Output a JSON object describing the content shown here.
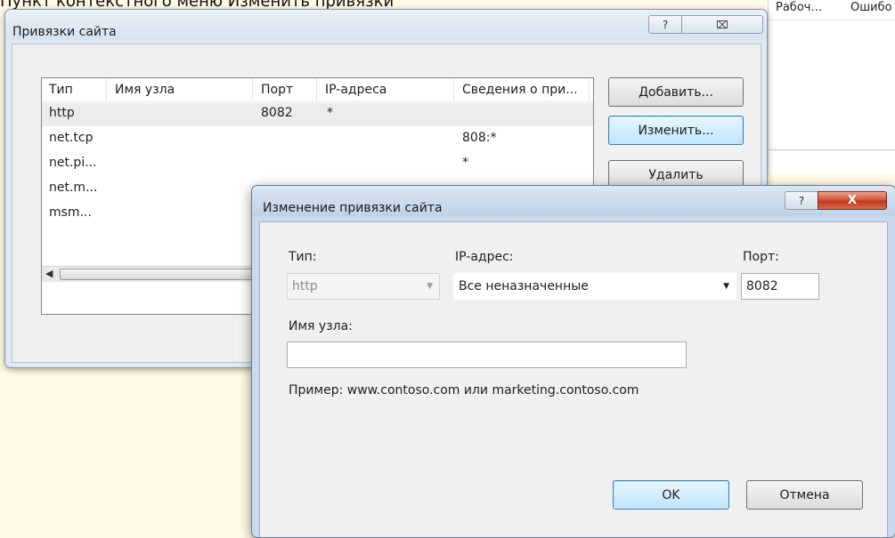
{
  "caption": "Пункт контекстного меню Изменить привязки",
  "background_window": {
    "col1": "Рабоч...",
    "col2": "Ошибо"
  },
  "bindings_dialog": {
    "title": "Привязки сайта",
    "help_glyph": "?",
    "close_glyph": "⌧",
    "columns": [
      "Тип",
      "Имя узла",
      "Порт",
      "IP-адреса",
      "Сведения о при..."
    ],
    "rows": [
      {
        "type": "http",
        "host": "",
        "port": "8082",
        "ip": "*",
        "info": ""
      },
      {
        "type": "net.tcp",
        "host": "",
        "port": "",
        "ip": "",
        "info": "808:*"
      },
      {
        "type": "net.pi...",
        "host": "",
        "port": "",
        "ip": "",
        "info": "*"
      },
      {
        "type": "net.m...",
        "host": "",
        "port": "",
        "ip": "",
        "info": ""
      },
      {
        "type": "msm...",
        "host": "",
        "port": "",
        "ip": "",
        "info": ""
      }
    ],
    "buttons": {
      "add": "Добавить...",
      "edit": "Изменить...",
      "remove": "Удалить"
    }
  },
  "edit_dialog": {
    "title": "Изменение привязки сайта",
    "help_glyph": "?",
    "close_glyph": "X",
    "type_label": "Тип:",
    "type_value": "http",
    "ip_label": "IP-адрес:",
    "ip_value": "Все неназначенные",
    "port_label": "Порт:",
    "port_value": "8082",
    "host_label": "Имя узла:",
    "host_value": "",
    "example": "Пример: www.contoso.com или marketing.contoso.com",
    "ok": "OK",
    "cancel": "Отмена"
  }
}
